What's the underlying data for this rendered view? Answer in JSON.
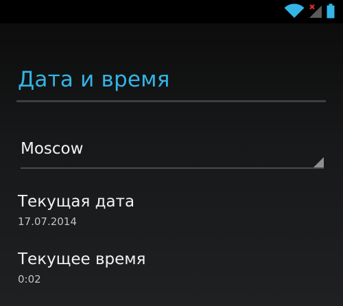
{
  "status_bar": {
    "icons": [
      "wifi-icon",
      "signal-no-service-icon",
      "battery-icon"
    ],
    "accent_color": "#33b5e5"
  },
  "screen": {
    "title": "Дата и время",
    "title_color": "#33b5e5"
  },
  "timezone": {
    "selected": "Moscow"
  },
  "current_date": {
    "label": "Текущая дата",
    "value": "17.07.2014"
  },
  "current_time": {
    "label": "Текущее время",
    "value": "0:02"
  }
}
